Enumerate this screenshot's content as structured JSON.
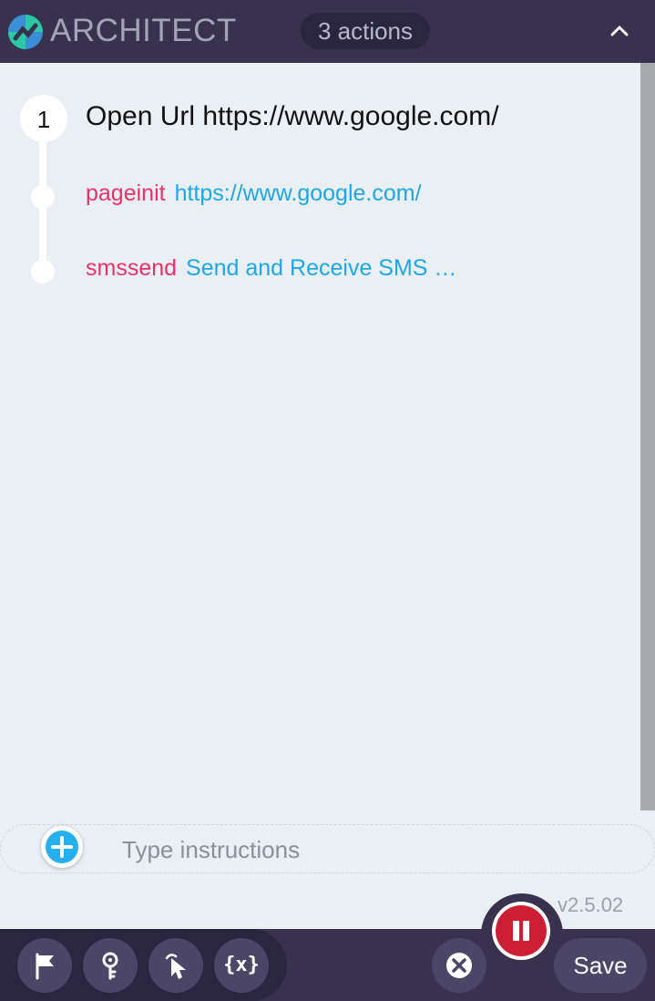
{
  "header": {
    "title": "ARCHITECT",
    "actions_count": "3 actions",
    "logo_icon": "architect-logo-icon",
    "collapse_icon": "chevron-up-icon"
  },
  "steps": [
    {
      "number": "1",
      "title": "Open Url https://www.google.com/",
      "sub_actions": [
        {
          "key": "pageinit",
          "value": "https://www.google.com/"
        },
        {
          "key": "smssend",
          "value": "Send and Receive SMS …"
        }
      ]
    }
  ],
  "instruction": {
    "placeholder": "Type instructions",
    "value": ""
  },
  "version": "v2.5.02",
  "footer": {
    "tools": [
      {
        "name": "flag",
        "icon": "flag-icon"
      },
      {
        "name": "key",
        "icon": "key-icon"
      },
      {
        "name": "pointer",
        "icon": "pointer-click-icon"
      },
      {
        "name": "variables",
        "icon": "variables-icon",
        "label": "{x}"
      }
    ],
    "pause_icon": "pause-icon",
    "cancel_icon": "close-circle-icon",
    "save_label": "Save"
  },
  "colors": {
    "header_bg": "#38324f",
    "body_bg": "#eaeff4",
    "key_color": "#e6336a",
    "link_color": "#1ea7e6",
    "pause_red": "#cc1f33",
    "add_blue": "#27b0ef"
  }
}
